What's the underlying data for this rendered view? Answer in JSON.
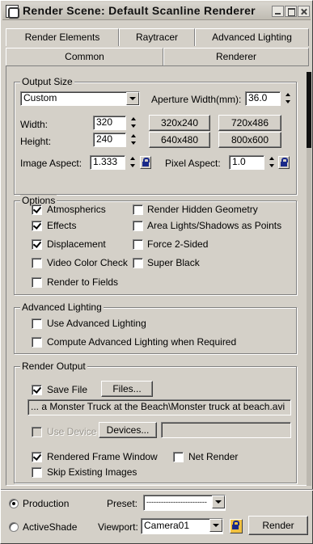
{
  "window": {
    "title": "Render Scene: Default Scanline Renderer"
  },
  "tabs": {
    "row1": [
      "Render Elements",
      "Raytracer",
      "Advanced Lighting"
    ],
    "row2": [
      "Common",
      "Renderer"
    ],
    "active": "Common"
  },
  "output_size": {
    "title": "Output Size",
    "preset": "Custom",
    "aperture_label": "Aperture Width(mm):",
    "aperture_value": "36.0",
    "width_label": "Width:",
    "width_value": "320",
    "height_label": "Height:",
    "height_value": "240",
    "presets": [
      "320x240",
      "720x486",
      "640x480",
      "800x600"
    ],
    "image_aspect_label": "Image Aspect:",
    "image_aspect_value": "1.333",
    "pixel_aspect_label": "Pixel Aspect:",
    "pixel_aspect_value": "1.0"
  },
  "options": {
    "title": "Options",
    "items": [
      {
        "label": "Atmospherics",
        "checked": true
      },
      {
        "label": "Render Hidden Geometry",
        "checked": false
      },
      {
        "label": "Effects",
        "checked": true
      },
      {
        "label": "Area Lights/Shadows as Points",
        "checked": false
      },
      {
        "label": "Displacement",
        "checked": true
      },
      {
        "label": "Force 2-Sided",
        "checked": false
      },
      {
        "label": "Video Color Check",
        "checked": false
      },
      {
        "label": "Super Black",
        "checked": false
      },
      {
        "label": "Render to Fields",
        "checked": false
      }
    ]
  },
  "advanced_lighting": {
    "title": "Advanced Lighting",
    "items": [
      {
        "label": "Use Advanced Lighting",
        "checked": false
      },
      {
        "label": "Compute Advanced Lighting when Required",
        "checked": false
      }
    ]
  },
  "render_output": {
    "title": "Render Output",
    "save_file_label": "Save File",
    "save_file_checked": true,
    "files_button": "Files...",
    "path": "... a Monster Truck at the Beach\\Monster truck at beach.avi",
    "use_device_label": "Use Device",
    "devices_button": "Devices...",
    "rendered_frame_window_label": "Rendered Frame Window",
    "rendered_frame_window_checked": true,
    "net_render_label": "Net Render",
    "net_render_checked": false,
    "skip_existing_label": "Skip Existing Images",
    "skip_existing_checked": false
  },
  "bottom": {
    "production_label": "Production",
    "activeshade_label": "ActiveShade",
    "mode_selected": "Production",
    "preset_label": "Preset:",
    "preset_value": "-------------------------",
    "viewport_label": "Viewport:",
    "viewport_value": "Camera01",
    "render_button": "Render"
  }
}
